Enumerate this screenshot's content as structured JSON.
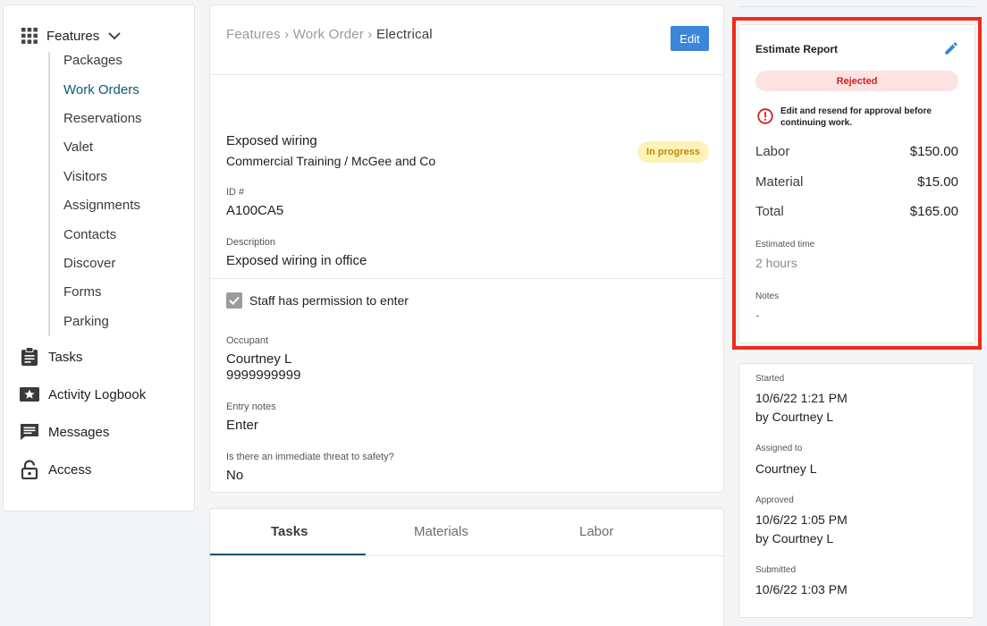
{
  "sidebar": {
    "features_label": "Features",
    "sub_items": [
      {
        "label": "Packages",
        "active": false
      },
      {
        "label": "Work Orders",
        "active": true
      },
      {
        "label": "Reservations",
        "active": false
      },
      {
        "label": "Valet",
        "active": false
      },
      {
        "label": "Visitors",
        "active": false
      },
      {
        "label": "Assignments",
        "active": false
      },
      {
        "label": "Contacts",
        "active": false
      },
      {
        "label": "Discover",
        "active": false
      },
      {
        "label": "Forms",
        "active": false
      },
      {
        "label": "Parking",
        "active": false
      }
    ],
    "main_items": [
      {
        "label": "Tasks",
        "icon": "clipboard-icon"
      },
      {
        "label": "Activity Logbook",
        "icon": "logbook-icon"
      },
      {
        "label": "Messages",
        "icon": "message-icon"
      },
      {
        "label": "Access",
        "icon": "lock-icon"
      }
    ]
  },
  "main": {
    "breadcrumb": {
      "part1": "Features",
      "sep": "›",
      "part2": "Work Order",
      "part3": "Electrical"
    },
    "edit_label": "Edit",
    "title": "Exposed wiring",
    "subtitle": "Commercial Training / McGee and Co",
    "status_badge": "In progress",
    "id_label": "ID #",
    "id_value": "A100CA5",
    "description_label": "Description",
    "description_value": "Exposed wiring in office",
    "permission_label": "Staff has permission to enter",
    "occupant_label": "Occupant",
    "occupant_name": "Courtney L",
    "occupant_phone": "9999999999",
    "entry_notes_label": "Entry notes",
    "entry_notes_value": "Enter",
    "threat_label": "Is there an immediate threat to safety?",
    "threat_value": "No"
  },
  "tabs": [
    {
      "label": "Tasks",
      "active": true
    },
    {
      "label": "Materials",
      "active": false
    },
    {
      "label": "Labor",
      "active": false
    }
  ],
  "estimate": {
    "title": "Estimate Report",
    "status": "Rejected",
    "warning": "Edit and resend for approval before continuing work.",
    "labor_label": "Labor",
    "labor_value": "$150.00",
    "material_label": "Material",
    "material_value": "$15.00",
    "total_label": "Total",
    "total_value": "$165.00",
    "estimated_time_label": "Estimated time",
    "estimated_time_value": "2 hours",
    "notes_label": "Notes",
    "notes_value": "-"
  },
  "timeline": {
    "started_label": "Started",
    "started_date": "10/6/22 1:21 PM",
    "started_by": "by Courtney L",
    "assigned_label": "Assigned to",
    "assigned_value": "Courtney L",
    "approved_label": "Approved",
    "approved_date": "10/6/22 1:05 PM",
    "approved_by": "by Courtney L",
    "submitted_label": "Submitted",
    "submitted_date": "10/6/22 1:03 PM"
  },
  "colors": {
    "accent": "#0c5a73",
    "edit_button": "#3b86d8",
    "highlight": "#ee2b1c",
    "rejected_bg": "#fde2e2",
    "rejected_text": "#d21f1f",
    "in_progress_bg": "#fdf2b8",
    "in_progress_text": "#c28a00"
  }
}
